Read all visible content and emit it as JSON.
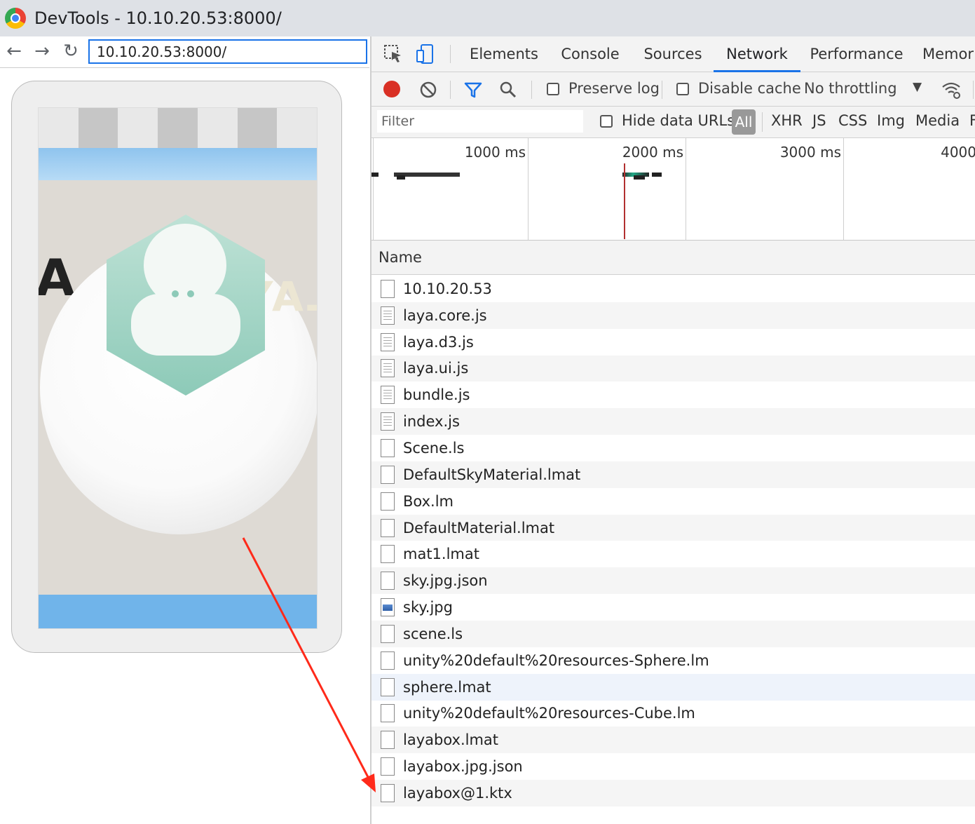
{
  "window": {
    "title": "DevTools - 10.10.20.53:8000/"
  },
  "browser": {
    "url": "10.10.20.53:8000/",
    "back_label": "←",
    "forward_label": "→",
    "reload_label": "↻"
  },
  "devtools": {
    "tabs": [
      "Elements",
      "Console",
      "Sources",
      "Network",
      "Performance",
      "Memor"
    ],
    "active_tab": "Network",
    "toolbar": {
      "preserve_log": "Preserve log",
      "disable_cache": "Disable cache",
      "throttling": "No throttling",
      "dropdown_glyph": "▼"
    },
    "filter": {
      "placeholder": "Filter",
      "hide_data_urls": "Hide data URLs",
      "types": [
        "All",
        "XHR",
        "JS",
        "CSS",
        "Img",
        "Media",
        "F"
      ]
    },
    "overview": {
      "ticks": [
        "1000 ms",
        "2000 ms",
        "3000 ms",
        "4000"
      ]
    },
    "requests": {
      "column_name": "Name",
      "files": [
        {
          "name": "10.10.20.53",
          "icon": "document"
        },
        {
          "name": "laya.core.js",
          "icon": "script"
        },
        {
          "name": "laya.d3.js",
          "icon": "script"
        },
        {
          "name": "laya.ui.js",
          "icon": "script"
        },
        {
          "name": "bundle.js",
          "icon": "script"
        },
        {
          "name": "index.js",
          "icon": "script"
        },
        {
          "name": "Scene.ls",
          "icon": "blank"
        },
        {
          "name": "DefaultSkyMaterial.lmat",
          "icon": "blank"
        },
        {
          "name": "Box.lm",
          "icon": "blank"
        },
        {
          "name": "DefaultMaterial.lmat",
          "icon": "blank"
        },
        {
          "name": "mat1.lmat",
          "icon": "blank"
        },
        {
          "name": "sky.jpg.json",
          "icon": "blank"
        },
        {
          "name": "sky.jpg",
          "icon": "image"
        },
        {
          "name": "scene.ls",
          "icon": "blank"
        },
        {
          "name": "unity%20default%20resources-Sphere.lm",
          "icon": "blank"
        },
        {
          "name": "sphere.lmat",
          "icon": "blank"
        },
        {
          "name": "unity%20default%20resources-Cube.lm",
          "icon": "blank"
        },
        {
          "name": "layabox.lmat",
          "icon": "blank"
        },
        {
          "name": "layabox.jpg.json",
          "icon": "blank"
        },
        {
          "name": "layabox@1.ktx",
          "icon": "blank"
        }
      ]
    }
  },
  "colors": {
    "accent": "#1a73e8",
    "record": "#d93025",
    "annotation_arrow": "#ff2a1a"
  }
}
